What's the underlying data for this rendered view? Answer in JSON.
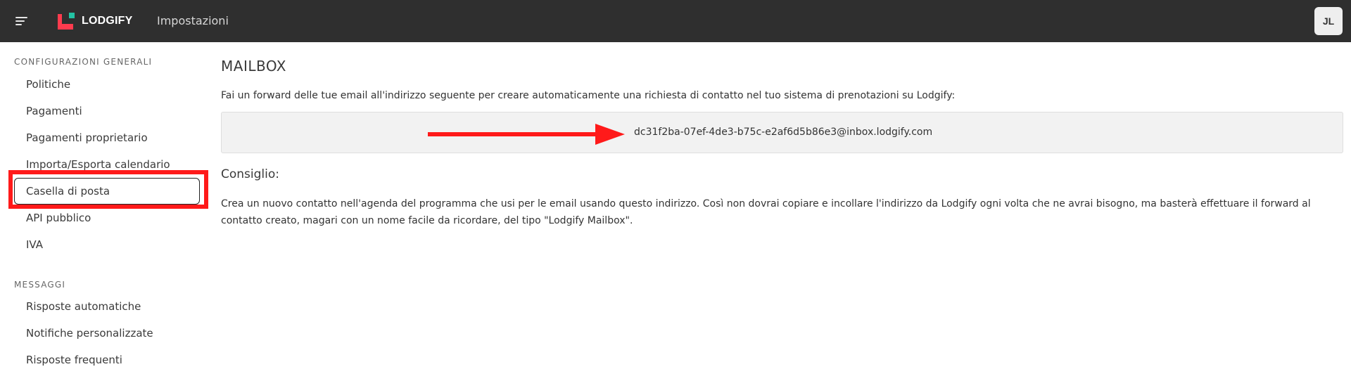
{
  "header": {
    "logo_text": "LODGIFY",
    "title": "Impostazioni",
    "avatar_initials": "JL",
    "colors": {
      "bar": "#2f2f2f",
      "logo_red": "#ff3b4e",
      "logo_teal": "#23c3a3"
    }
  },
  "sidebar": {
    "sections": [
      {
        "title": "CONFIGURAZIONI GENERALI",
        "items": [
          {
            "label": "Politiche"
          },
          {
            "label": "Pagamenti"
          },
          {
            "label": "Pagamenti proprietario"
          },
          {
            "label": "Importa/Esporta calendario"
          },
          {
            "label": "Casella di posta",
            "active": true
          },
          {
            "label": "API pubblico"
          },
          {
            "label": "IVA"
          }
        ]
      },
      {
        "title": "MESSAGGI",
        "items": [
          {
            "label": "Risposte automatiche"
          },
          {
            "label": "Notifiche personalizzate"
          },
          {
            "label": "Risposte frequenti"
          }
        ]
      }
    ],
    "highlight_color": "#ff1a1a"
  },
  "main": {
    "title": "MAILBOX",
    "intro": "Fai un forward delle tue email all'indirizzo seguente per creare automaticamente una richiesta di contatto nel tuo sistema di prenotazioni su Lodgify:",
    "email": "dc31f2ba-07ef-4de3-b75c-e2af6d5b86e3@inbox.lodgify.com",
    "tip_title": "Consiglio:",
    "tip_text": "Crea un nuovo contatto nell'agenda del programma che usi per le email usando questo indirizzo. Così non dovrai copiare e incollare l'indirizzo da Lodgify ogni volta che ne avrai bisogno, ma basterà effettuare il forward al contatto creato, magari con un nome facile da ricordare, del tipo \"Lodgify Mailbox\".",
    "arrow_color": "#ff1a1a"
  }
}
